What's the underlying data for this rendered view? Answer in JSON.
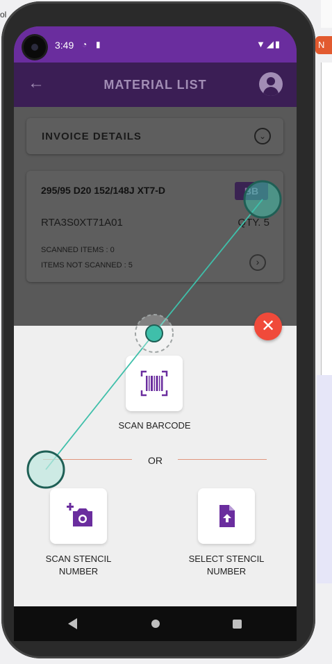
{
  "status_bar": {
    "time": "3:49"
  },
  "app_bar": {
    "title": "MATERIAL LIST"
  },
  "invoice": {
    "label": "INVOICE DETAILS"
  },
  "item": {
    "name": "295/95 D20 152/148J XT7-D",
    "badge": "BB",
    "code": "RTA3S0XT71A01",
    "qty": "QTY. 5",
    "scanned": "SCANNED ITEMS : 0",
    "not_scanned": "ITEMS NOT SCANNED : 5"
  },
  "sheet": {
    "scan_barcode": "SCAN BARCODE",
    "or": "OR",
    "scan_stencil": "SCAN STENCIL NUMBER",
    "select_stencil": "SELECT STENCIL NUMBER"
  },
  "colors": {
    "brand": "#6a2d9e",
    "close": "#f04a3a",
    "touch": "#3fbfaa"
  },
  "icons": [
    "back-arrow-icon",
    "account-icon",
    "chevron-down-icon",
    "chevron-right-icon",
    "close-icon",
    "barcode-icon",
    "add-photo-icon",
    "file-upload-icon"
  ]
}
